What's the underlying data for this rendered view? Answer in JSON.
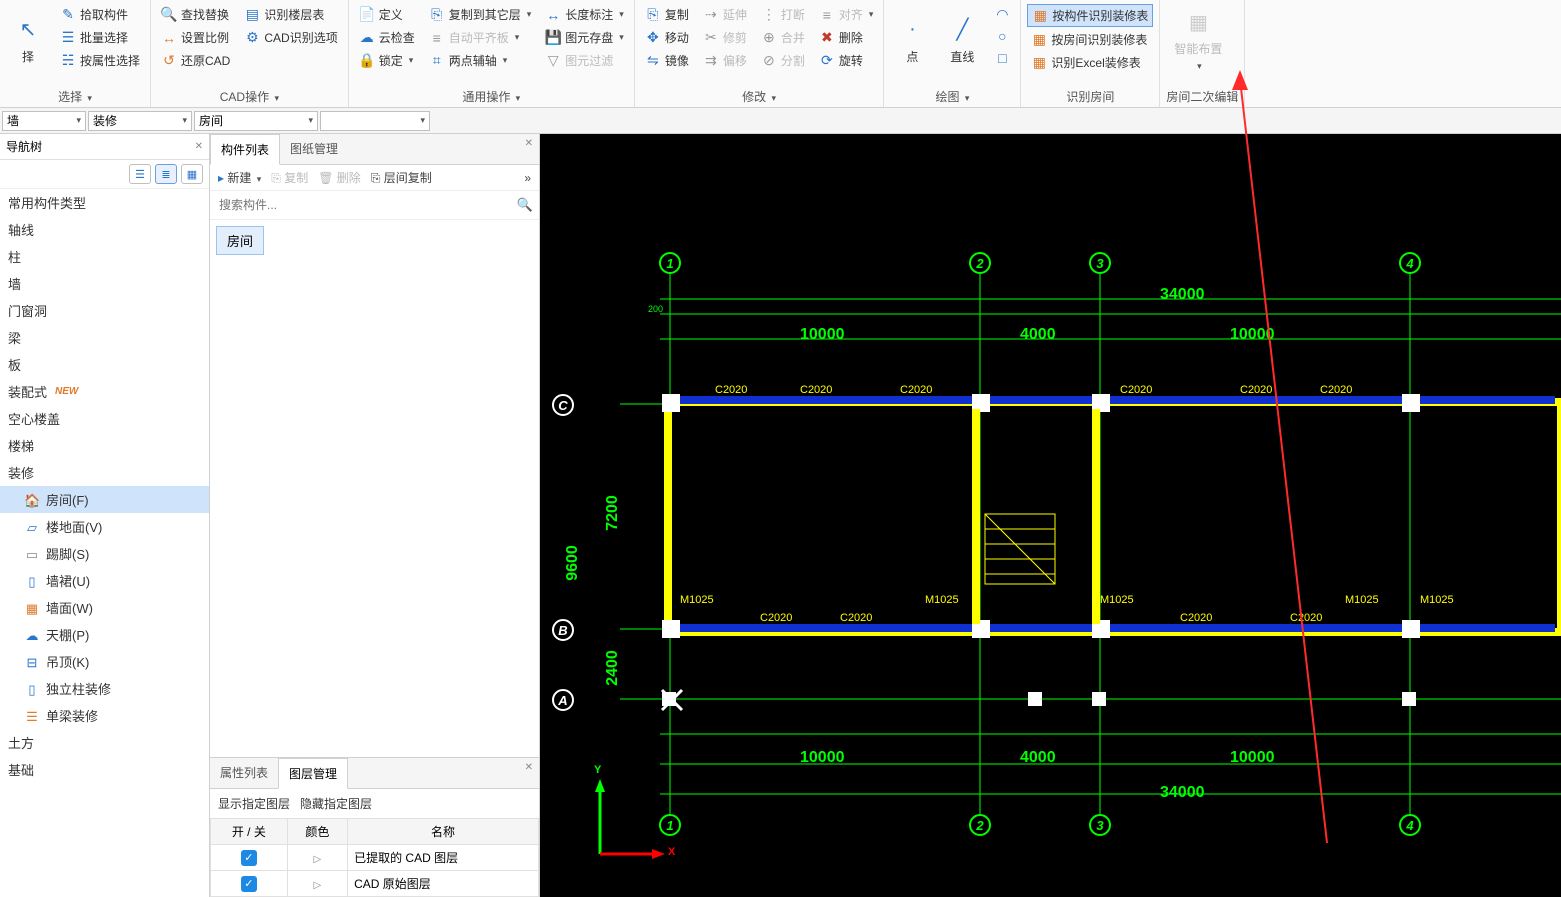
{
  "ribbon": {
    "select": {
      "label": "选择",
      "pick_arrow": "择",
      "pick": "拾取构件",
      "batch": "批量选择",
      "by_attr": "按属性选择"
    },
    "cad": {
      "label": "CAD操作",
      "find_replace": "查找替换",
      "set_scale": "设置比例",
      "restore": "还原CAD",
      "recog_layers": "识别楼层表",
      "recog_options": "CAD识别选项"
    },
    "general": {
      "label": "通用操作",
      "define": "定义",
      "cloud_check": "云检查",
      "lock": "锁定",
      "copy_to_other": "复制到其它层",
      "auto_level": "自动平齐板",
      "two_point_aux": "两点辅轴",
      "length_annot": "长度标注",
      "save_primitive": "图元存盘",
      "filter_primitive": "图元过滤"
    },
    "modify": {
      "label": "修改",
      "copy": "复制",
      "move": "移动",
      "mirror": "镜像",
      "extend": "延伸",
      "trim": "修剪",
      "offset": "偏移",
      "break": "打断",
      "merge": "合并",
      "split": "分割",
      "align": "对齐",
      "delete": "删除",
      "rotate": "旋转"
    },
    "draw": {
      "label": "绘图",
      "point": "点",
      "line": "直线",
      "rect": "□"
    },
    "recog_room": {
      "label": "识别房间",
      "by_component": "按构件识别装修表",
      "by_room": "按房间识别装修表",
      "excel": "识别Excel装修表"
    },
    "room_edit": {
      "label": "房间二次编辑",
      "smart_layout": "智能布置"
    }
  },
  "dropbar": {
    "d1": "墙",
    "d2": "装修",
    "d3": "房间",
    "d4": ""
  },
  "nav": {
    "title": "导航树",
    "items": [
      {
        "label": "常用构件类型",
        "lvl": 1
      },
      {
        "label": "轴线",
        "lvl": 1
      },
      {
        "label": "柱",
        "lvl": 1
      },
      {
        "label": "墙",
        "lvl": 1
      },
      {
        "label": "门窗洞",
        "lvl": 1
      },
      {
        "label": "梁",
        "lvl": 1
      },
      {
        "label": "板",
        "lvl": 1
      },
      {
        "label": "装配式",
        "lvl": 1,
        "new": true
      },
      {
        "label": "空心楼盖",
        "lvl": 1
      },
      {
        "label": "楼梯",
        "lvl": 1
      },
      {
        "label": "装修",
        "lvl": 1
      },
      {
        "label": "房间(F)",
        "lvl": 2,
        "icon": "🏠",
        "color": "#e07b2a",
        "selected": true
      },
      {
        "label": "楼地面(V)",
        "lvl": 2,
        "icon": "▱",
        "color": "#2a74c9"
      },
      {
        "label": "踢脚(S)",
        "lvl": 2,
        "icon": "▭",
        "color": "#888"
      },
      {
        "label": "墙裙(U)",
        "lvl": 2,
        "icon": "▯",
        "color": "#2a74c9"
      },
      {
        "label": "墙面(W)",
        "lvl": 2,
        "icon": "▦",
        "color": "#e07b2a"
      },
      {
        "label": "天棚(P)",
        "lvl": 2,
        "icon": "☁",
        "color": "#2a74c9"
      },
      {
        "label": "吊顶(K)",
        "lvl": 2,
        "icon": "⊟",
        "color": "#2a74c9"
      },
      {
        "label": "独立柱装修",
        "lvl": 2,
        "icon": "▯",
        "color": "#2a74c9"
      },
      {
        "label": "单梁装修",
        "lvl": 2,
        "icon": "☰",
        "color": "#e07b2a"
      },
      {
        "label": "土方",
        "lvl": 1
      },
      {
        "label": "基础",
        "lvl": 1
      }
    ]
  },
  "mid": {
    "tabs": {
      "components": "构件列表",
      "drawings": "图纸管理"
    },
    "toolbar": {
      "new": "新建",
      "copy": "复制",
      "delete": "删除",
      "layer_copy": "层间复制"
    },
    "search_placeholder": "搜索构件...",
    "component": "房间",
    "bottom_tabs": {
      "attrs": "属性列表",
      "layers": "图层管理"
    },
    "layer_cmds": {
      "show": "显示指定图层",
      "hide": "隐藏指定图层"
    },
    "layer_headers": {
      "onoff": "开 / 关",
      "color": "颜色",
      "name": "名称"
    },
    "layers": [
      {
        "name": "已提取的 CAD 图层"
      },
      {
        "name": "CAD 原始图层"
      }
    ]
  },
  "cad": {
    "grid_top_nums": [
      "1",
      "2",
      "3",
      "4"
    ],
    "grid_bottom_nums": [
      "1",
      "2",
      "3",
      "4"
    ],
    "grid_left_letters": [
      "C",
      "B",
      "A"
    ],
    "dim_total": "34000",
    "dim_seg": [
      "10000",
      "4000",
      "10000"
    ],
    "dim_left_up": "7200",
    "dim_left_down": "2400",
    "dim_left_total": "9600",
    "col_labels": "C2020",
    "beam_labels": "M1025",
    "side_dim": "200",
    "axes": {
      "x": "X",
      "y": "Y"
    }
  }
}
